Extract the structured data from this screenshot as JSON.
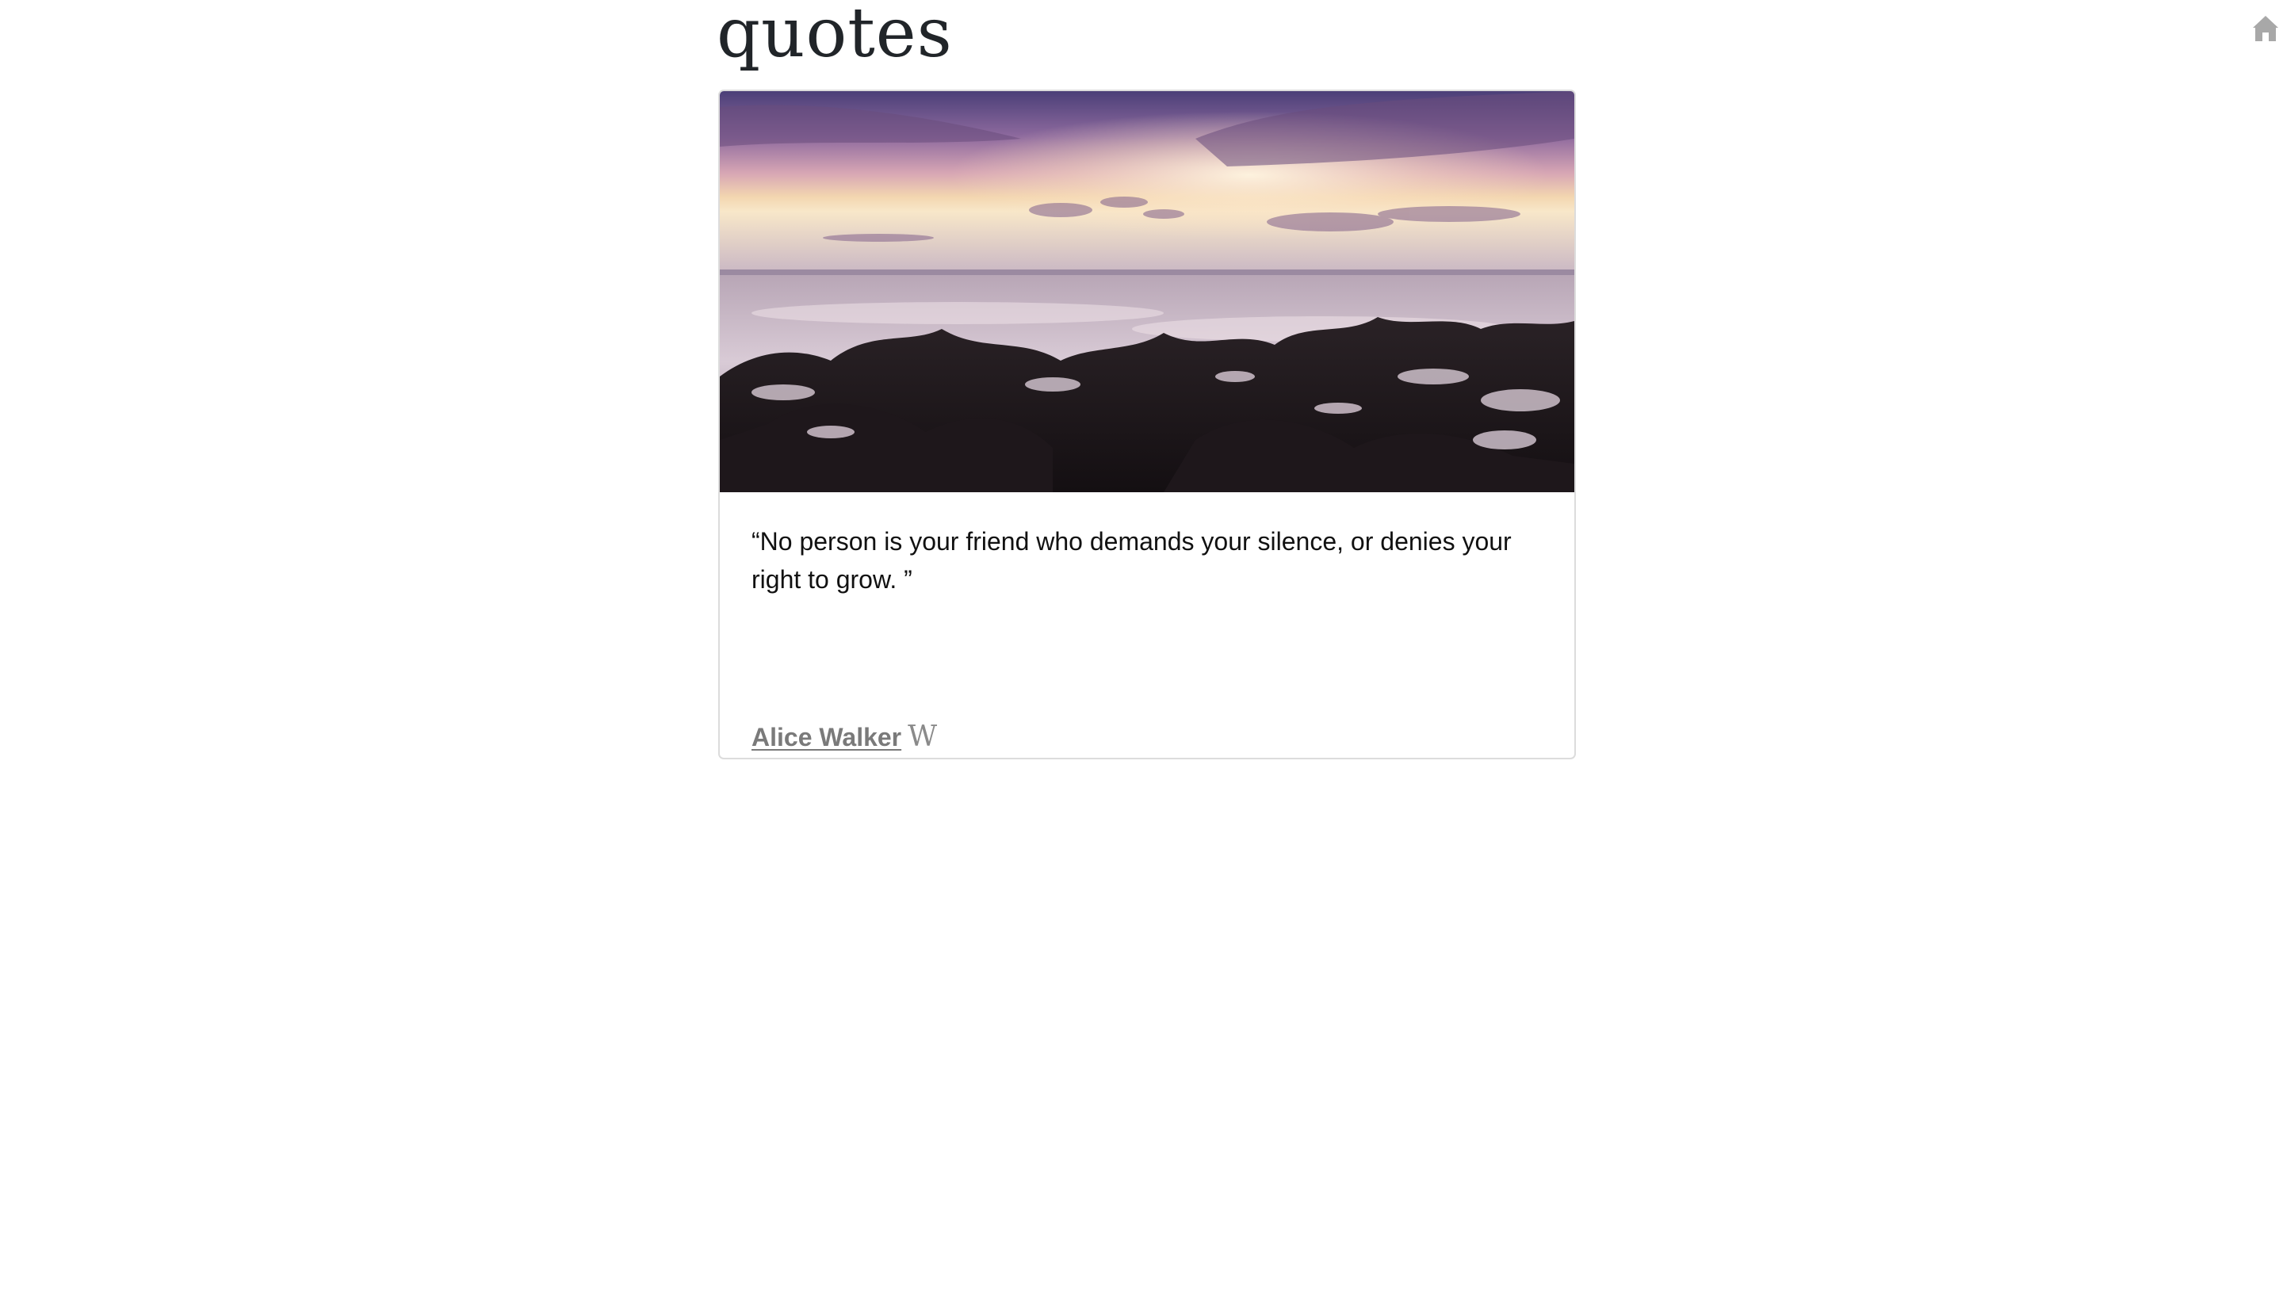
{
  "page": {
    "title": "quotes"
  },
  "nav": {
    "home_icon": "home-icon"
  },
  "quote": {
    "text": "“No person is your friend who demands your silence, or denies your right to grow. ”",
    "author": "Alice Walker ",
    "wiki_icon_glyph": "W",
    "image_description_icon": "seascape-photo"
  },
  "actions": {
    "tweet_icon": "twitter-icon",
    "like_icon": "heart-icon"
  },
  "colors": {
    "accent": "#1d7af3",
    "title": "#212529",
    "author_link": "#7a7a7a",
    "home_icon": "#a8a8a8"
  }
}
